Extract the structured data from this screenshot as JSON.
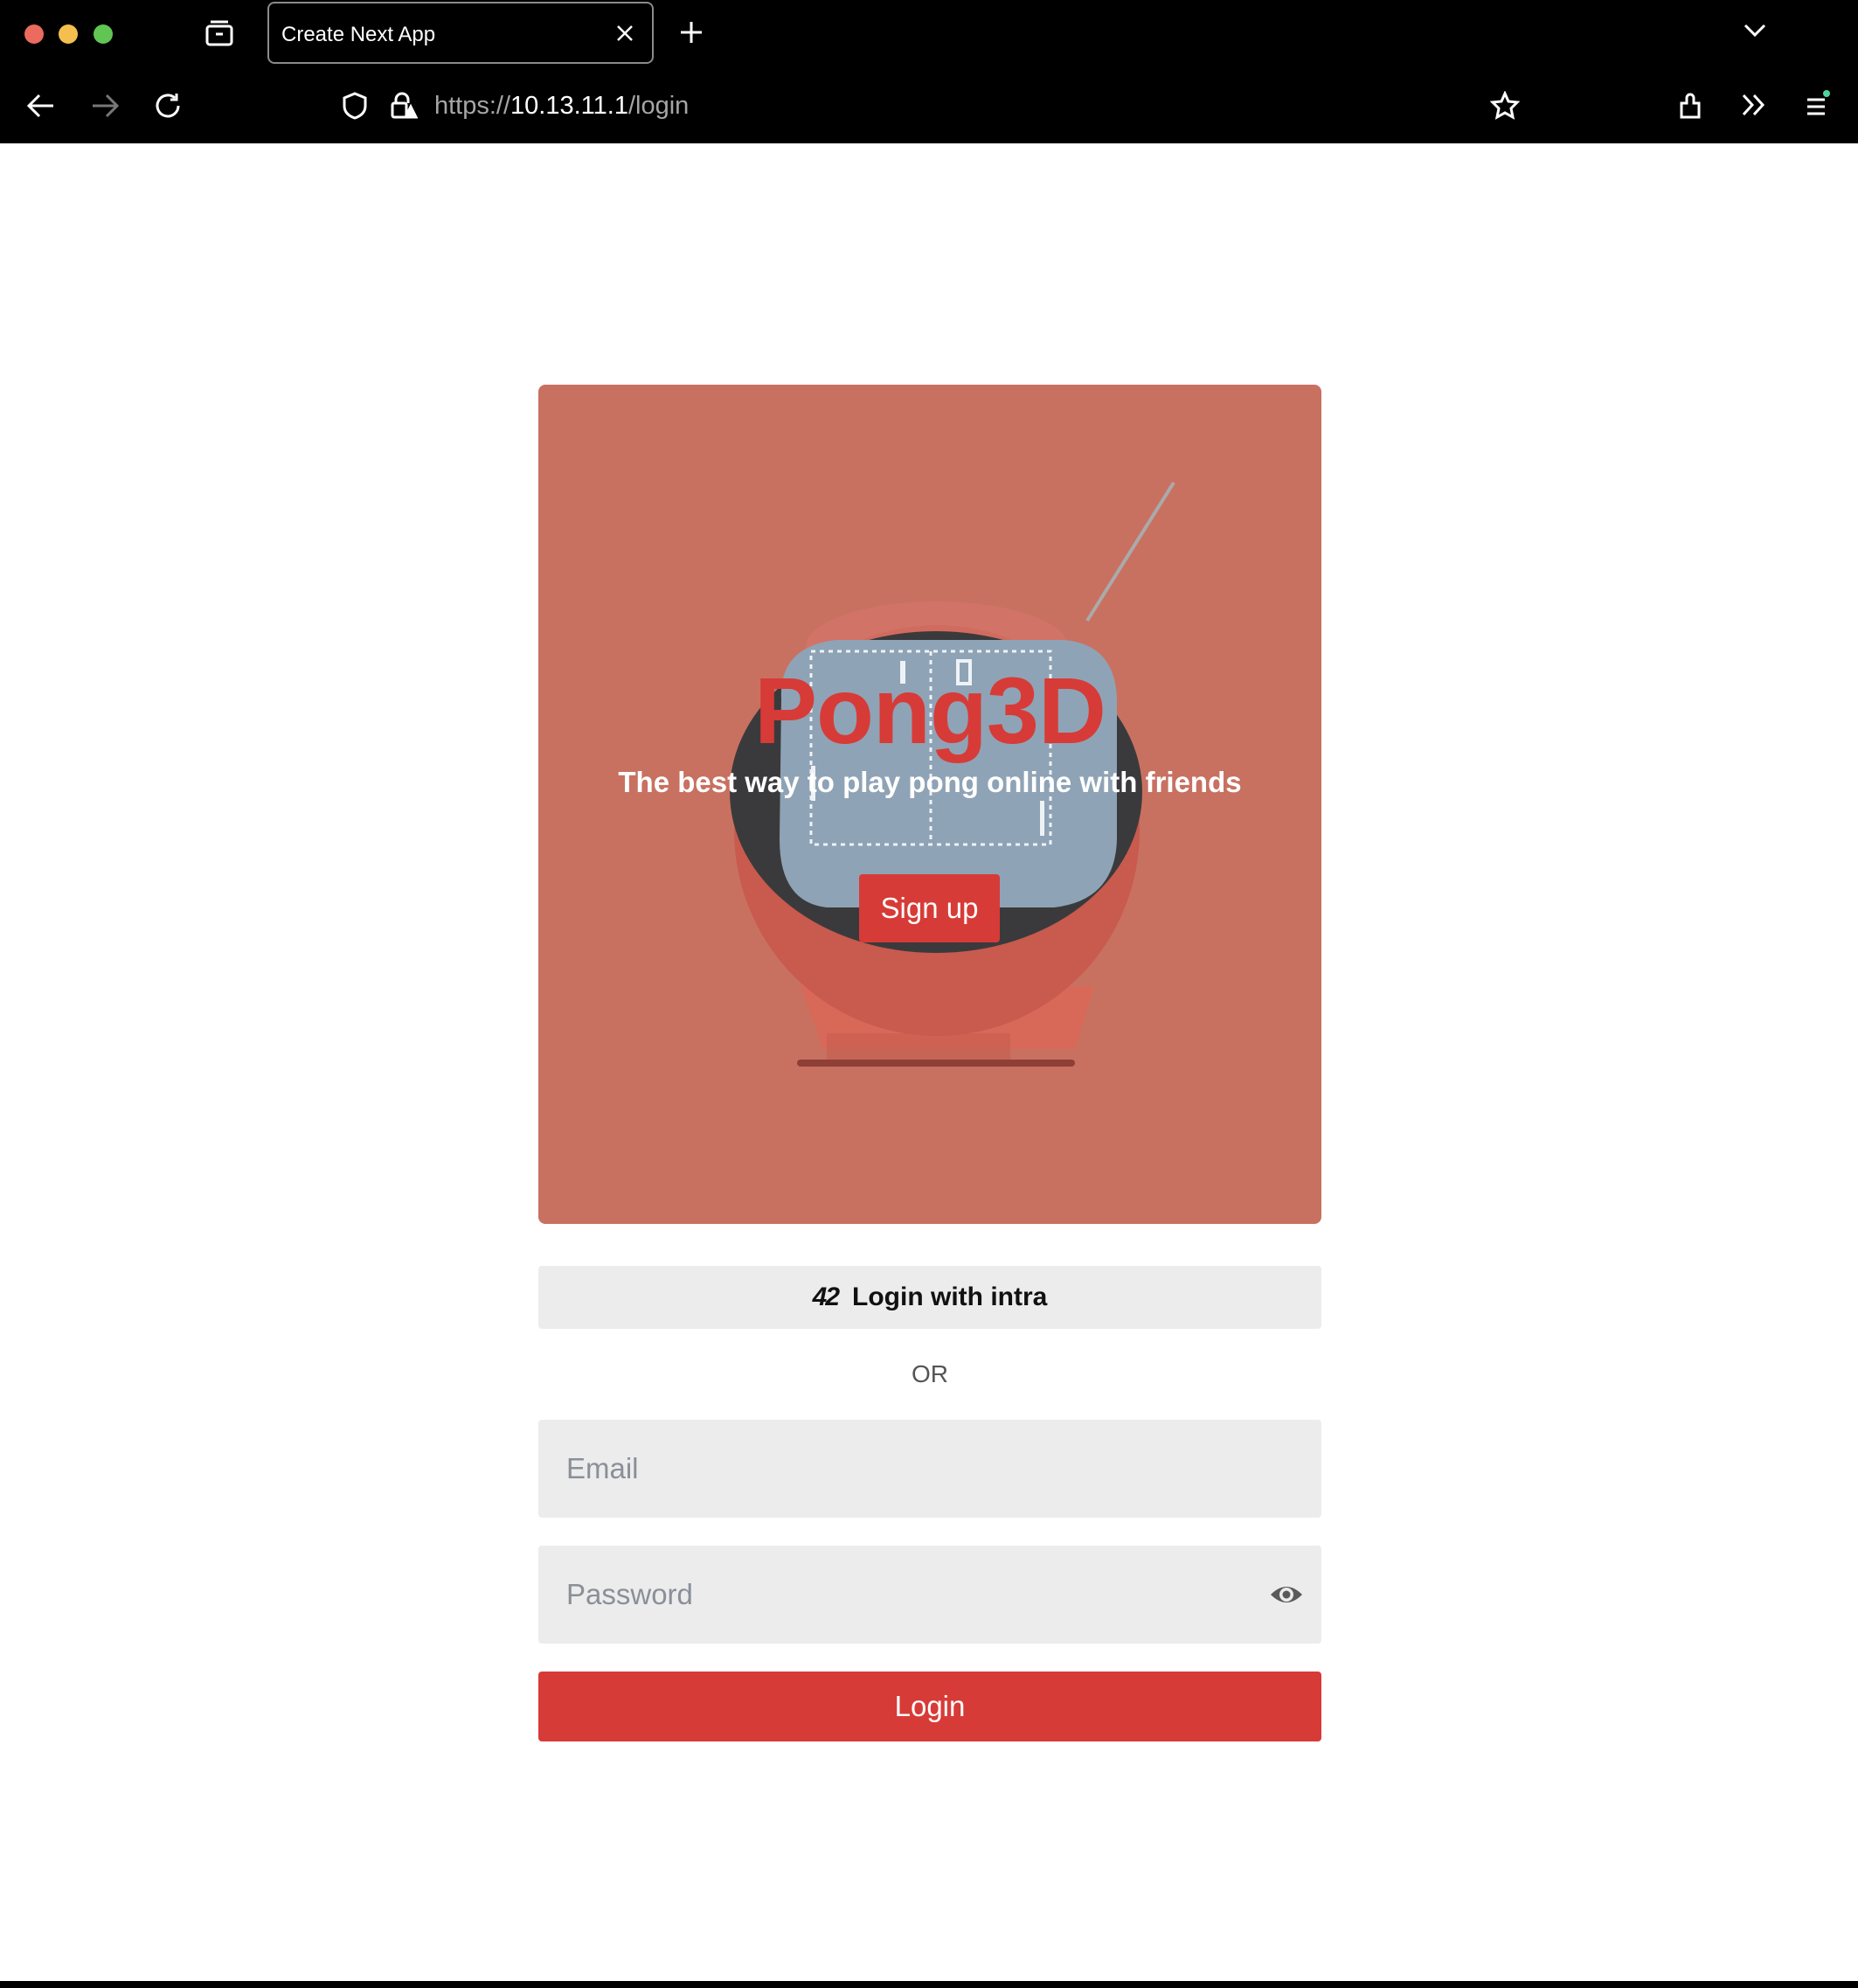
{
  "browser": {
    "tab_title": "Create Next App",
    "url_scheme": "https://",
    "url_host": "10.13.11.1",
    "url_path": "/login"
  },
  "hero": {
    "title": "Pong3D",
    "subtitle": "The best way to play pong online with friends",
    "signup_label": "Sign up"
  },
  "auth": {
    "intra_logo": "42",
    "intra_label": "Login with intra",
    "or_text": "OR",
    "email_placeholder": "Email",
    "password_placeholder": "Password",
    "login_label": "Login"
  },
  "colors": {
    "accent": "#d73b37",
    "hero_background": "#c87161",
    "field_background": "#ececec"
  }
}
